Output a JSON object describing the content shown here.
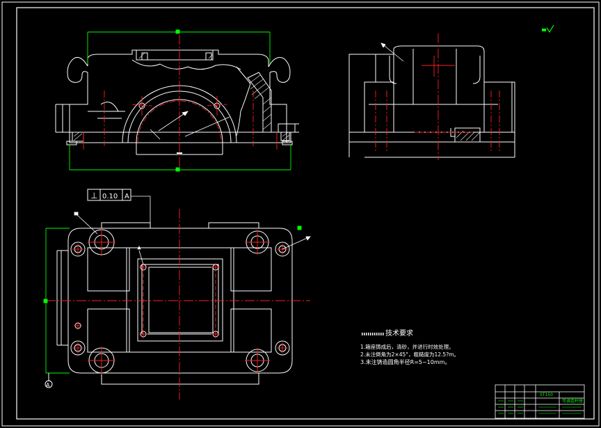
{
  "gdt": {
    "symbol": "⊥",
    "tolerance": "0.10",
    "datum": "A"
  },
  "datum_label": "A",
  "tech": {
    "title": "技术要求",
    "notes": [
      "1.箱座铸成后，清砂，并进行时效处理。",
      "2.未注倒角为2×45°，粗糙度为12.5?m。",
      "3.未注铸造圆角半径R=5~10mm。"
    ]
  },
  "title_block": {
    "code": "ST150",
    "name": "可调连杆座"
  },
  "colors": {
    "outline": "#ffffff",
    "center": "#ff2020",
    "dimension": "#00ff00",
    "background": "#000000"
  }
}
